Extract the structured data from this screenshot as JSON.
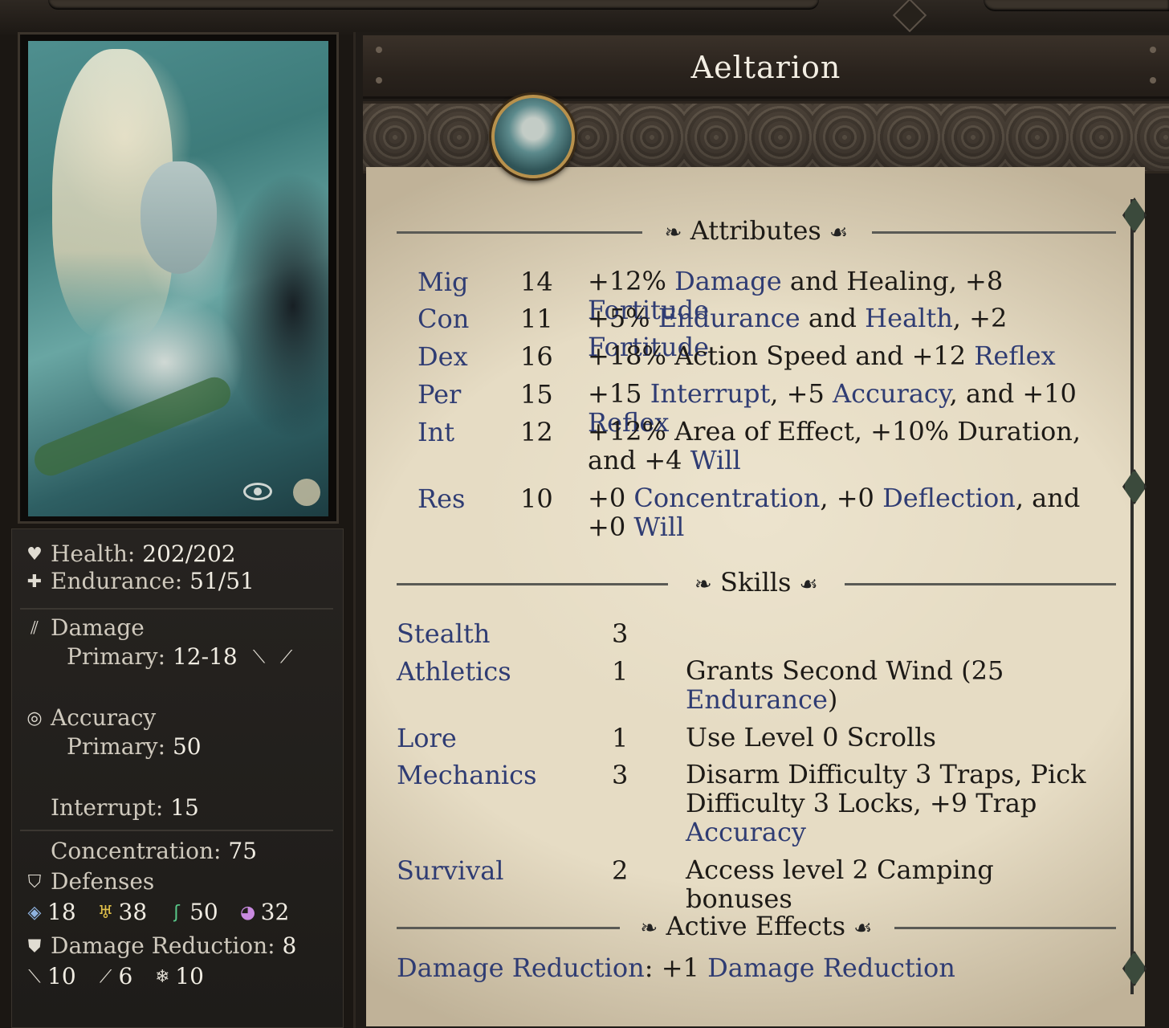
{
  "character": {
    "name": "Aeltarion"
  },
  "stats": {
    "health_label": "Health:",
    "health_value": "202/202",
    "endurance_label": "Endurance:",
    "endurance_value": "51/51",
    "damage_label": "Damage",
    "damage_primary_label": "Primary:",
    "damage_primary_value": "12-18",
    "accuracy_label": "Accuracy",
    "accuracy_primary_label": "Primary:",
    "accuracy_primary_value": "50",
    "interrupt_label": "Interrupt:",
    "interrupt_value": "15",
    "concentration_label": "Concentration:",
    "concentration_value": "75",
    "defenses_label": "Defenses",
    "defenses": [
      {
        "icon": "deflection-icon",
        "value": "18"
      },
      {
        "icon": "fortitude-icon",
        "value": "38"
      },
      {
        "icon": "reflex-icon",
        "value": "50"
      },
      {
        "icon": "will-icon",
        "value": "32"
      }
    ],
    "damage_reduction_label": "Damage Reduction:",
    "damage_reduction_value": "8",
    "damage_reduction_types": [
      {
        "icon": "slash-icon",
        "value": "10"
      },
      {
        "icon": "pierce-icon",
        "value": "6"
      },
      {
        "icon": "freeze-icon",
        "value": "10"
      }
    ]
  },
  "attributes_title": "Attributes",
  "attributes": [
    {
      "abbr": "Mig",
      "value": "14",
      "desc": [
        [
          "+12% ",
          ""
        ],
        [
          "Damage",
          "kw"
        ],
        [
          " and Healing, +8 ",
          ""
        ],
        [
          "Fortitude",
          "kw"
        ]
      ]
    },
    {
      "abbr": "Con",
      "value": "11",
      "desc": [
        [
          "+5% ",
          ""
        ],
        [
          "Endurance",
          "kw"
        ],
        [
          " and ",
          ""
        ],
        [
          "Health",
          "kw"
        ],
        [
          ", +2 ",
          ""
        ],
        [
          "Fortitude",
          "kw"
        ]
      ]
    },
    {
      "abbr": "Dex",
      "value": "16",
      "desc": [
        [
          "+18% Action Speed and +12 ",
          ""
        ],
        [
          "Reflex",
          "kw"
        ]
      ]
    },
    {
      "abbr": "Per",
      "value": "15",
      "desc": [
        [
          "+15 ",
          ""
        ],
        [
          "Interrupt",
          "kw"
        ],
        [
          ", +5 ",
          ""
        ],
        [
          "Accuracy",
          "kw"
        ],
        [
          ", and +10 ",
          ""
        ],
        [
          "Reflex",
          "kw"
        ]
      ]
    },
    {
      "abbr": "Int",
      "value": "12",
      "desc": [
        [
          "+12% Area of Effect, +10% Duration, and +4 ",
          ""
        ],
        [
          "Will",
          "kw"
        ]
      ]
    },
    {
      "abbr": "Res",
      "value": "10",
      "desc": [
        [
          "+0 ",
          ""
        ],
        [
          "Concentration",
          "kw"
        ],
        [
          ", +0 ",
          ""
        ],
        [
          "Deflection",
          "kw"
        ],
        [
          ", and +0 ",
          ""
        ],
        [
          "Will",
          "kw"
        ]
      ]
    }
  ],
  "skills_title": "Skills",
  "skills": [
    {
      "name": "Stealth",
      "value": "3",
      "desc": []
    },
    {
      "name": "Athletics",
      "value": "1",
      "desc": [
        [
          "Grants Second Wind (25 ",
          ""
        ],
        [
          "Endurance",
          "kw"
        ],
        [
          ")",
          ""
        ]
      ]
    },
    {
      "name": "Lore",
      "value": "1",
      "desc": [
        [
          "Use Level 0 Scrolls",
          ""
        ]
      ]
    },
    {
      "name": "Mechanics",
      "value": "3",
      "desc": [
        [
          "Disarm Difficulty 3 Traps, Pick Difficulty 3 Locks, +9 Trap ",
          ""
        ],
        [
          "Accuracy",
          "kw"
        ]
      ]
    },
    {
      "name": "Survival",
      "value": "2",
      "desc": [
        [
          "Access level 2 Camping bonuses",
          ""
        ]
      ]
    }
  ],
  "effects_title": "Active Effects",
  "effects": [
    [
      [
        "Damage Reduction",
        "kw"
      ],
      [
        ": +1 ",
        ""
      ],
      [
        "Damage Reduction",
        "kw"
      ]
    ]
  ],
  "colors": {
    "keyword": "#2f3c73",
    "parchment": "#e6dcc4",
    "panel": "#1e1c19"
  }
}
